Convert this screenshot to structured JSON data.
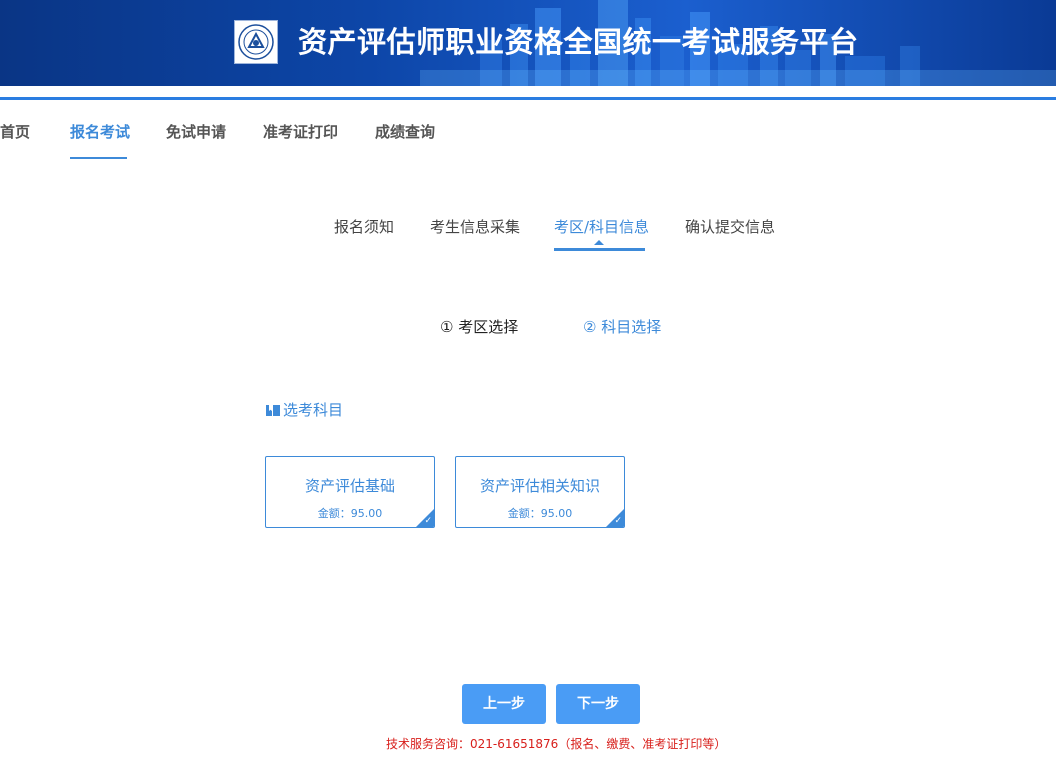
{
  "header": {
    "title": "资产评估师职业资格全国统一考试服务平台",
    "logo_icon": "association-seal-icon",
    "colors": {
      "banner": "#0d46a8",
      "accent": "#3d8ad9",
      "button": "#4a9cf5",
      "note": "#d8201c"
    }
  },
  "nav": {
    "items": [
      {
        "label": "首页",
        "active": false
      },
      {
        "label": "报名考试",
        "active": true
      },
      {
        "label": "免试申请",
        "active": false
      },
      {
        "label": "准考证打印",
        "active": false
      },
      {
        "label": "成绩查询",
        "active": false
      }
    ]
  },
  "steps": {
    "items": [
      {
        "label": "报名须知",
        "active": false
      },
      {
        "label": "考生信息采集",
        "active": false
      },
      {
        "label": "考区/科目信息",
        "active": true
      },
      {
        "label": "确认提交信息",
        "active": false
      }
    ]
  },
  "substeps": {
    "items": [
      {
        "label": "① 考区选择",
        "state": "done"
      },
      {
        "label": "② 科目选择",
        "state": "current"
      }
    ]
  },
  "subjects": {
    "section_title": "选考科目",
    "section_icon": "book-icon",
    "cards": [
      {
        "name": "资产评估基础",
        "fee": "金额：95.00",
        "selected": true
      },
      {
        "name": "资产评估相关知识",
        "fee": "金额：95.00",
        "selected": true
      }
    ]
  },
  "actions": {
    "prev_label": "上一步",
    "next_label": "下一步"
  },
  "footer": {
    "note": "技术服务咨询：021-61651876（报名、缴费、准考证打印等）"
  }
}
